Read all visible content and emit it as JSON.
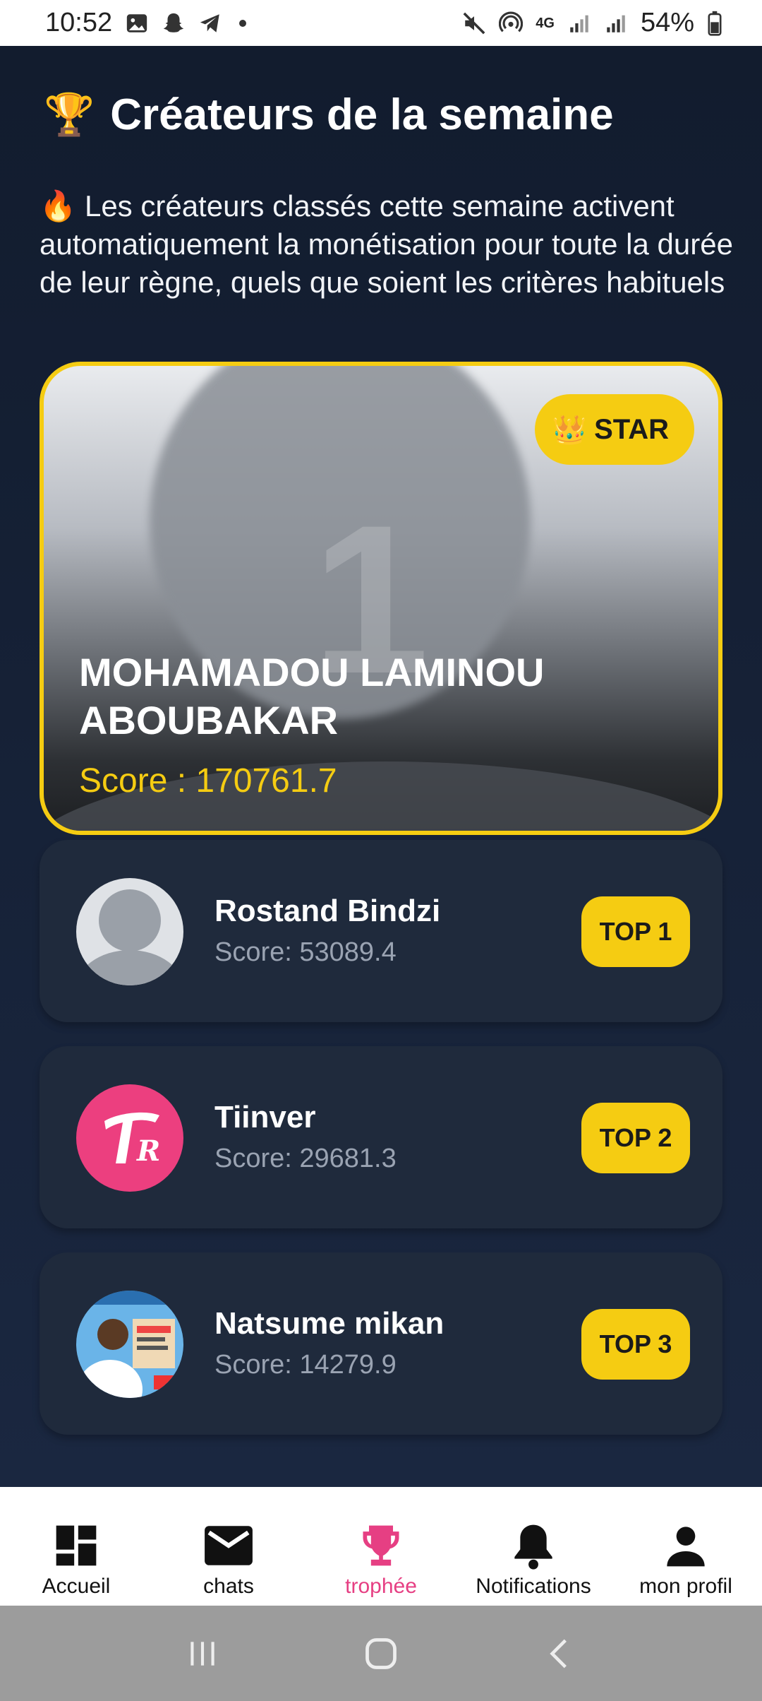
{
  "status_bar": {
    "time": "10:52",
    "battery": "54%",
    "network": "4G"
  },
  "header": {
    "title": "Créateurs de la semaine",
    "trophy_emoji": "🏆"
  },
  "intro": {
    "fire_emoji": "🔥",
    "line1": "Les créateurs classés cette semaine activent",
    "line2": "automatiquement la monétisation pour toute la durée",
    "line3": "de leur règne, quels que soient les critères habituels"
  },
  "star_card": {
    "badge_emoji": "👑",
    "badge_label": "STAR",
    "rank_number": "1",
    "name": "MOHAMADOU LAMINOU ABOUBAKAR",
    "score_text": "Score : 170761.7"
  },
  "rankings": [
    {
      "name": "Rostand Bindzi",
      "score_text": "Score: 53089.4",
      "badge": "TOP 1"
    },
    {
      "name": "Tiinver",
      "score_text": "Score: 29681.3",
      "badge": "TOP 2"
    },
    {
      "name": "Natsume mikan",
      "score_text": "Score: 14279.9",
      "badge": "TOP 3"
    }
  ],
  "bottom_nav": {
    "items": [
      {
        "label": "Accueil",
        "icon": "dashboard-icon"
      },
      {
        "label": "chats",
        "icon": "mail-icon"
      },
      {
        "label": "trophée",
        "icon": "trophy-icon",
        "active": true
      },
      {
        "label": "Notifications",
        "icon": "bell-icon"
      },
      {
        "label": "mon profil",
        "icon": "person-icon"
      }
    ]
  },
  "colors": {
    "background": "#18243a",
    "card": "#1f2a3c",
    "accent_yellow": "#f5cc12",
    "active_nav": "#e63f83",
    "muted_text": "#9aa3b2"
  }
}
